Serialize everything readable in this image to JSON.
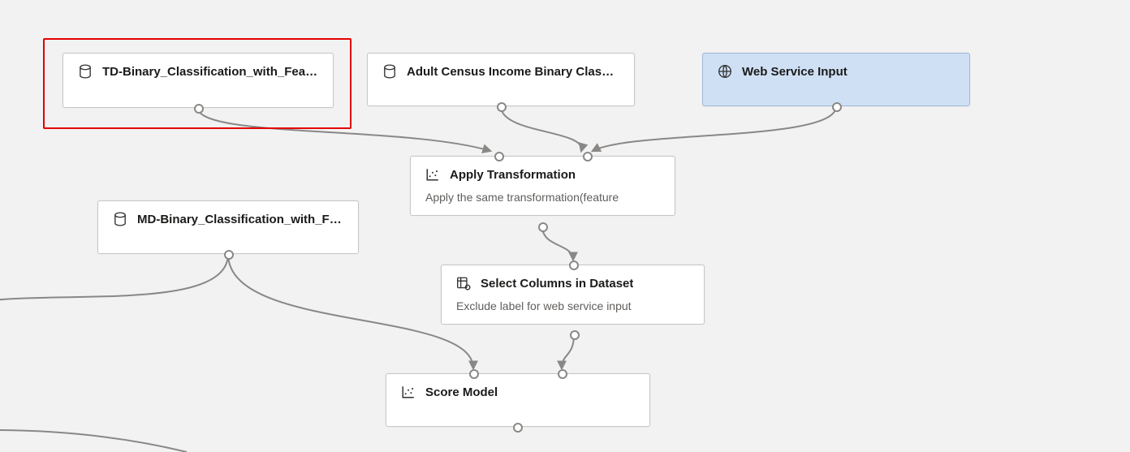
{
  "nodes": {
    "td": {
      "title": "TD-Binary_Classification_with_Feat..."
    },
    "adult": {
      "title": "Adult Census Income Binary Classi..."
    },
    "wsi": {
      "title": "Web Service Input"
    },
    "md": {
      "title": "MD-Binary_Classification_with_Fea..."
    },
    "apply": {
      "title": "Apply Transformation",
      "sub": "Apply the same transformation(feature"
    },
    "select": {
      "title": "Select Columns in Dataset",
      "sub": "Exclude label for web service input"
    },
    "score": {
      "title": "Score Model"
    }
  }
}
